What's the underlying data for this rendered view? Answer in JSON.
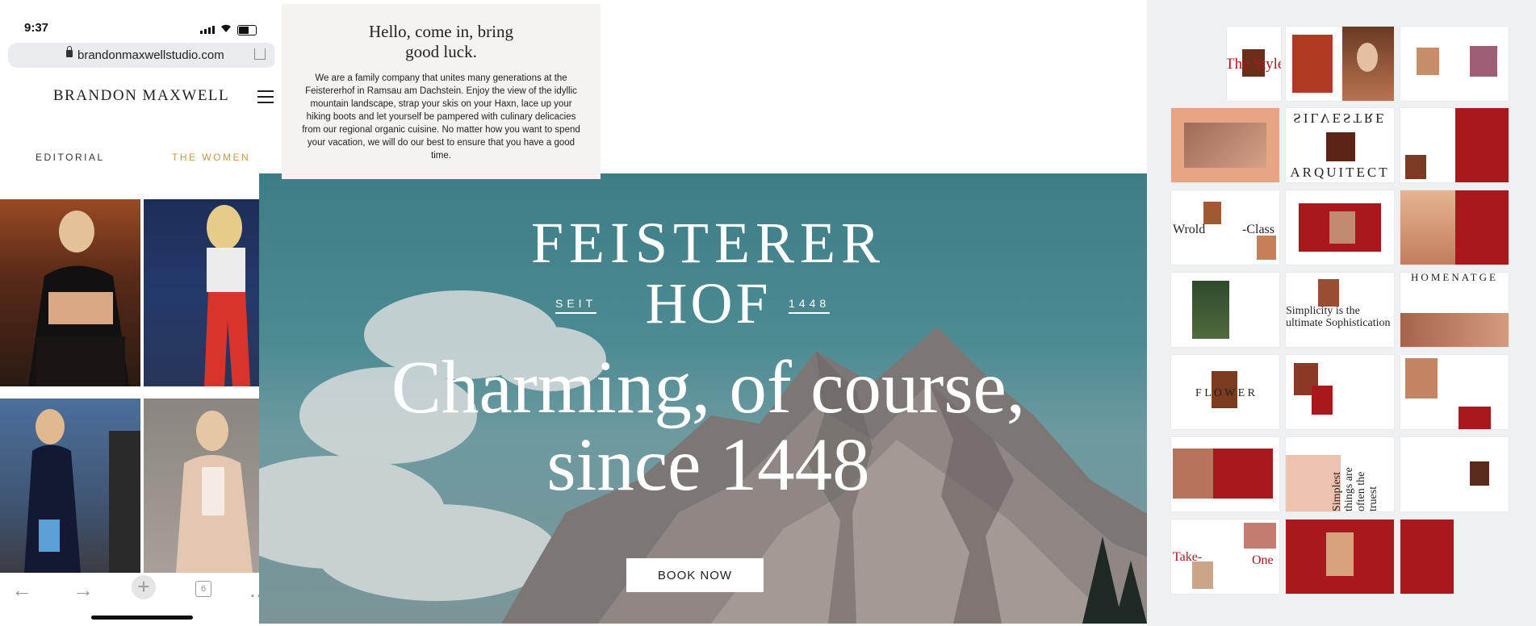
{
  "phone": {
    "time": "9:37",
    "url": "brandonmaxwellstudio.com",
    "brand": "BRANDON MAXWELL",
    "tabs": [
      "EDITORIAL",
      "THE WOMEN"
    ],
    "tab_active_color": "#c39a4f",
    "toolbar": {
      "back": "←",
      "forward": "→",
      "new_tab": "+",
      "tab_count": "6",
      "more": "…"
    }
  },
  "hotel_card": {
    "heading": "Hello, come in, bring good luck.",
    "body": "We are a family company that unites many generations at the Feistererhof in Ramsau am Dachstein. Enjoy the view of the idyllic mountain landscape, strap your skis on your Haxn, lace up your hiking boots and let yourself be pampered with culinary delicacies from our regional organic cuisine. No matter how you want to spend your vacation, we will do our best to ensure that you have a good time."
  },
  "hero": {
    "logo_line1": "FEISTERER",
    "logo_line2": "HOF",
    "seit": "SEIT",
    "year": "1448",
    "headline_line1": "Charming, of course,",
    "headline_line2": "since 1448",
    "cta": "BOOK NOW"
  },
  "mockups": {
    "texts": {
      "the_style": "The Style",
      "silvestre": "SILVESTRE",
      "arquitect": "ARQUITECT",
      "wrold": "Wrold",
      "class": "-Class",
      "homenatge": "HOMENATGE",
      "simplicity": "Simplicity is the ultimate Sophistication",
      "flower": "F L O W E R",
      "simplest": "Simplest things are often the truest",
      "take": "Take-",
      "one": "One"
    },
    "accent_red": "#a8191b",
    "accent_peach": "#e8a584"
  }
}
